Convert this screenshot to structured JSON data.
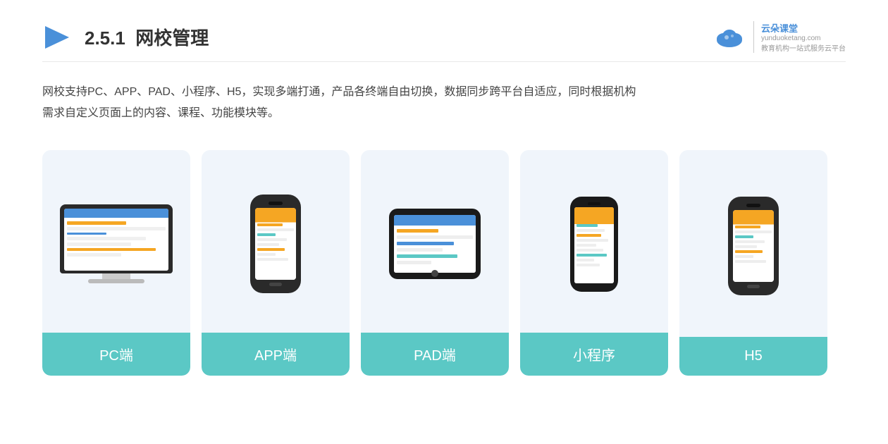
{
  "header": {
    "section_number": "2.5.1",
    "title": "网校管理",
    "brand": {
      "name": "云朵课堂",
      "domain": "yunduoketang.com",
      "slogan1": "教育机构一站",
      "slogan2": "式服务云平台"
    }
  },
  "description": {
    "line1": "网校支持PC、APP、PAD、小程序、H5，实现多端打通，产品各终端自由切换，数据同步跨平台自适应，同时根据机构",
    "line2": "需求自定义页面上的内容、课程、功能模块等。"
  },
  "cards": [
    {
      "id": "pc",
      "label": "PC端",
      "device_type": "pc"
    },
    {
      "id": "app",
      "label": "APP端",
      "device_type": "phone"
    },
    {
      "id": "pad",
      "label": "PAD端",
      "device_type": "tablet"
    },
    {
      "id": "miniprogram",
      "label": "小程序",
      "device_type": "mini-phone"
    },
    {
      "id": "h5",
      "label": "H5",
      "device_type": "phone2"
    }
  ]
}
